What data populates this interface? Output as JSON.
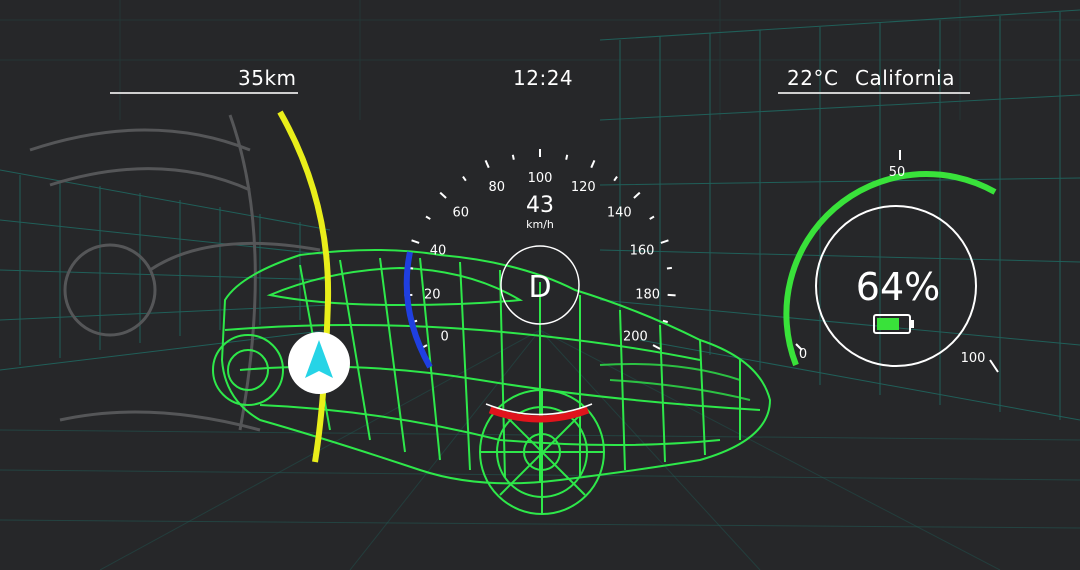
{
  "header": {
    "distance": "35km",
    "time": "12:24",
    "temperature": "22°C",
    "location": "California"
  },
  "speedometer": {
    "speed": "43",
    "unit": "km/h",
    "gear": "D",
    "scale_labels": [
      "0",
      "20",
      "40",
      "60",
      "80",
      "100",
      "120",
      "140",
      "160",
      "180",
      "200"
    ]
  },
  "battery": {
    "percent_text": "64%",
    "level": 0.64,
    "scale_labels": [
      "0",
      "50",
      "100"
    ]
  },
  "colors": {
    "background": "#262729",
    "wireframe": "#2ee84a",
    "grid": "#1f6e66",
    "speed_arc": "#1f3fe0",
    "yellow_arc": "#e9ee1a",
    "battery_arc": "#39e23a",
    "brake_arc": "#e0141c",
    "nav_arrow": "#26d4e6"
  },
  "icons": {
    "navigation": "navigation-arrow-icon",
    "battery": "battery-icon",
    "car": "car-wireframe-icon"
  }
}
